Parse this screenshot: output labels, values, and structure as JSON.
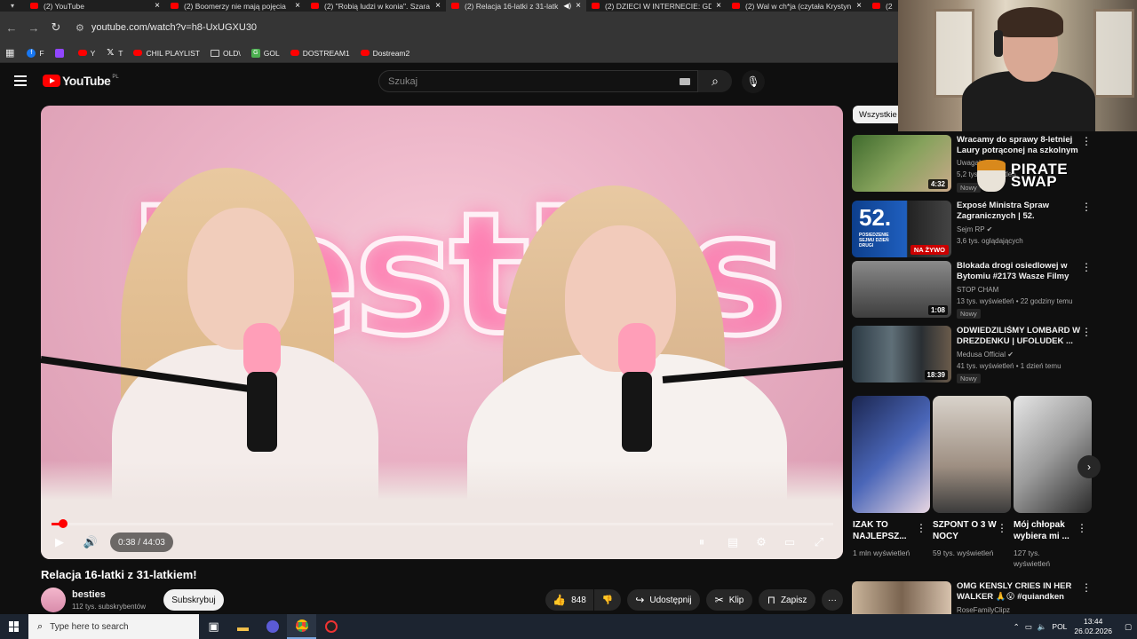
{
  "browser": {
    "tabs": [
      {
        "title": "(2) YouTube",
        "active": false
      },
      {
        "title": "(2) Boomerzy nie mają pojęcia",
        "active": false
      },
      {
        "title": "(2) \"Robią ludzi w konia\". Szara",
        "active": false
      },
      {
        "title": "(2) Relacja 16-latki z 31-latk",
        "active": true,
        "audio": true
      },
      {
        "title": "(2) DZIECI W INTERNECIE: GDZ",
        "active": false
      },
      {
        "title": "(2) Wal w ch*ja (czytała Krystyn",
        "active": false
      },
      {
        "title": "(2",
        "active": false
      }
    ],
    "url": "youtube.com/watch?v=h8-UxUGXU30",
    "bookmarks": [
      "F",
      "",
      "Y",
      "T",
      "CHIL PLAYLIST",
      "OLD\\",
      "GOL",
      "DOSTREAM1",
      "Dostream2"
    ]
  },
  "youtube": {
    "logo_text": "YouTube",
    "logo_region": "PL",
    "search_placeholder": "Szukaj"
  },
  "player": {
    "neon_text": "besties",
    "time": "0:38 / 44:03",
    "progress_fraction": 0.0144
  },
  "video": {
    "title": "Relacja 16-latki z 31-latkiem!",
    "channel": "besties",
    "subscribers": "112 tys. subskrybentów",
    "subscribe_label": "Subskrybuj",
    "likes": "848",
    "share_label": "Udostępnij",
    "clip_label": "Klip",
    "save_label": "Zapisz"
  },
  "sidebar": {
    "chip": "Wszystkie",
    "recommendations": [
      {
        "title": "Wracamy do sprawy 8-letniej Laury potrąconej na szkolnym ...",
        "channel": "Uwaga!",
        "meta": "5,2 tys. wyświetleń",
        "badge": "Nowy",
        "duration": "4:32"
      },
      {
        "title": "Exposé Ministra Spraw Zagranicznych | 52. posiedzen...",
        "channel": "Sejm RP",
        "meta": "3,6 tys. oglądających",
        "badge": "",
        "duration": "",
        "live": "NA ŻYWO",
        "thumb_number": "52.",
        "thumb_caption": "POSIEDZENIE SEJMU DZIEŃ DRUGI"
      },
      {
        "title": "Blokada drogi osiedlowej w Bytomiu #2173 Wasze Filmy",
        "channel": "STOP CHAM",
        "meta": "13 tys. wyświetleń • 22 godziny temu",
        "badge": "Nowy",
        "duration": "1:08"
      },
      {
        "title": "ODWIEDZILIŚMY LOMBARD W DREZDENKU | UFOLUDEK ...",
        "channel": "Medusa Official",
        "meta": "41 tys. wyświetleń • 1 dzień temu",
        "badge": "Nowy",
        "duration": "18:39"
      },
      {
        "title": "OMG KENSLY CRIES IN HER WALKER 🙏😮 #quiandken",
        "channel": "RoseFamilyClipz",
        "meta": "",
        "badge": "",
        "duration": ""
      }
    ],
    "shorts": [
      {
        "title": "IZAK TO NAJLEPSZ...",
        "views": "1 mln wyświetleń"
      },
      {
        "title": "SZPONT O 3 W NOCY",
        "views": "59 tys. wyświetleń"
      },
      {
        "title": "Mój chłopak wybiera mi ...",
        "views": "127 tys. wyświetleń"
      }
    ]
  },
  "overlay": {
    "sponsor_line1": "PIRATE",
    "sponsor_line2": "SWAP"
  },
  "taskbar": {
    "search_placeholder": "Type here to search",
    "language": "POL",
    "time": "13:44",
    "date": "26.02.2026"
  },
  "colors": {
    "accent": "#ff0000",
    "background": "#0f0f0f",
    "live": "#cc0000"
  }
}
